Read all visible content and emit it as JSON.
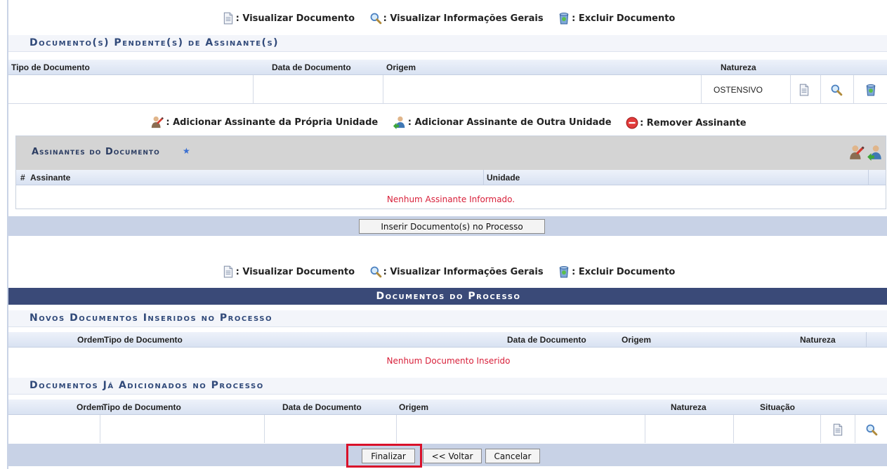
{
  "legend_docs": {
    "view_doc": ": Visualizar Documento",
    "view_info": ": Visualizar Informações Gerais",
    "delete_doc": ": Excluir Documento"
  },
  "legend_signers": {
    "add_own": ": Adicionar Assinante da Própria Unidade",
    "add_other": ": Adicionar Assinante de Outra Unidade",
    "remove": ": Remover Assinante"
  },
  "pending": {
    "title": "Documento(s) Pendente(s) de Assinante(s)",
    "columns": {
      "tipo": "Tipo de Documento",
      "data": "Data de Documento",
      "origem": "Origem",
      "natureza": "Natureza"
    },
    "row": {
      "tipo": "",
      "data": "",
      "origem": "",
      "natureza": "OSTENSIVO"
    }
  },
  "signers": {
    "title": "Assinantes do Documento",
    "required_mark": "★",
    "columns": {
      "num": "#",
      "assinante": "Assinante",
      "unidade": "Unidade"
    },
    "empty": "Nenhum Assinante Informado.",
    "insert_button": "Inserir Documento(s) no Processo"
  },
  "process": {
    "title": "Documentos do Processo",
    "new_section": {
      "title": "Novos Documentos Inseridos no Processo",
      "columns": {
        "ordem": "Ordem",
        "tipo": "Tipo de Documento",
        "data": "Data de Documento",
        "origem": "Origem",
        "natureza": "Natureza"
      },
      "empty": "Nenhum Documento Inserido"
    },
    "added_section": {
      "title": "Documentos Já Adicionados no Processo",
      "columns": {
        "ordem": "Ordem",
        "tipo": "Tipo de Documento",
        "data": "Data de Documento",
        "origem": "Origem",
        "natureza": "Natureza",
        "situacao": "Situação"
      }
    }
  },
  "footer": {
    "finalizar": "Finalizar",
    "voltar": "<< Voltar",
    "cancelar": "Cancelar"
  },
  "colors": {
    "highlight": "#d9112a",
    "error_text": "#d8203a",
    "dark_header": "#3a4a78"
  }
}
